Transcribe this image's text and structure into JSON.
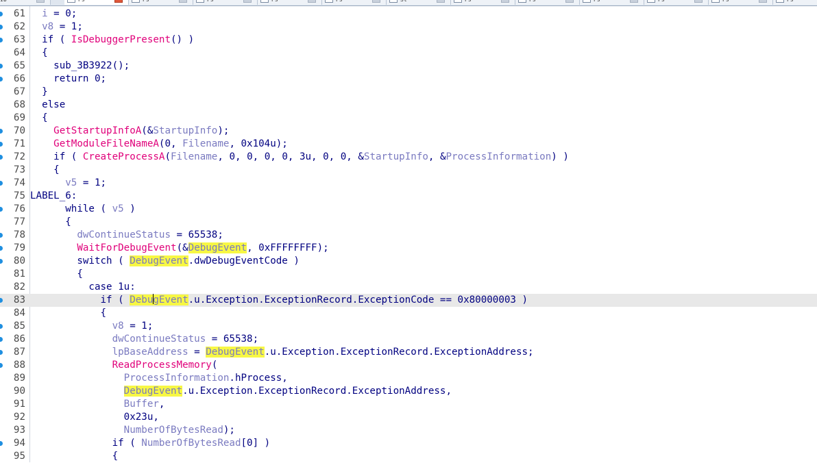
{
  "tabs": [
    {
      "label": "Ib",
      "active": false
    },
    {
      "label": "Ps",
      "active": true
    },
    {
      "label": "Ps",
      "active": false
    },
    {
      "label": "Ps",
      "active": false
    },
    {
      "label": "Ps",
      "active": false
    },
    {
      "label": "Ps",
      "active": false
    },
    {
      "label": "St",
      "active": false
    },
    {
      "label": "Ps",
      "active": false
    },
    {
      "label": "Ps",
      "active": false
    },
    {
      "label": "Ps",
      "active": false
    },
    {
      "label": "Ps",
      "active": false
    },
    {
      "label": "Ps",
      "active": false
    },
    {
      "label": "Ps",
      "active": false
    },
    {
      "label": "Ps",
      "active": false
    }
  ],
  "colors": {
    "keyword": "#000080",
    "variable": "#7a7ac0",
    "function": "#e0007a",
    "highlight": "#f7f744",
    "current_line": "#e8e8e8",
    "gutter_dot": "#1f8fe0"
  },
  "highlight_word": "DebugEvent",
  "current_line": 83,
  "lines": [
    {
      "num": "61",
      "dot": true,
      "tokens": [
        [
          "p",
          "  "
        ],
        [
          "v",
          "i"
        ],
        [
          "p",
          " = 0;"
        ]
      ]
    },
    {
      "num": "62",
      "dot": true,
      "tokens": [
        [
          "p",
          "  "
        ],
        [
          "v",
          "v8"
        ],
        [
          "p",
          " = 1;"
        ]
      ]
    },
    {
      "num": "63",
      "dot": true,
      "tokens": [
        [
          "p",
          "  if ( "
        ],
        [
          "f",
          "IsDebuggerPresent"
        ],
        [
          "p",
          "() )"
        ]
      ]
    },
    {
      "num": "64",
      "dot": false,
      "tokens": [
        [
          "p",
          "  {"
        ]
      ]
    },
    {
      "num": "65",
      "dot": true,
      "tokens": [
        [
          "p",
          "    sub_3B3922();"
        ]
      ]
    },
    {
      "num": "66",
      "dot": true,
      "tokens": [
        [
          "p",
          "    return 0;"
        ]
      ]
    },
    {
      "num": "67",
      "dot": false,
      "tokens": [
        [
          "p",
          "  }"
        ]
      ]
    },
    {
      "num": "68",
      "dot": false,
      "tokens": [
        [
          "p",
          "  else"
        ]
      ]
    },
    {
      "num": "69",
      "dot": false,
      "tokens": [
        [
          "p",
          "  {"
        ]
      ]
    },
    {
      "num": "70",
      "dot": true,
      "tokens": [
        [
          "p",
          "    "
        ],
        [
          "f",
          "GetStartupInfoA"
        ],
        [
          "p",
          "(&"
        ],
        [
          "v",
          "StartupInfo"
        ],
        [
          "p",
          ");"
        ]
      ]
    },
    {
      "num": "71",
      "dot": true,
      "tokens": [
        [
          "p",
          "    "
        ],
        [
          "f",
          "GetModuleFileNameA"
        ],
        [
          "p",
          "(0, "
        ],
        [
          "v",
          "Filename"
        ],
        [
          "p",
          ", 0x104u);"
        ]
      ]
    },
    {
      "num": "72",
      "dot": true,
      "tokens": [
        [
          "p",
          "    if ( "
        ],
        [
          "f",
          "CreateProcessA"
        ],
        [
          "p",
          "("
        ],
        [
          "v",
          "Filename"
        ],
        [
          "p",
          ", 0, 0, 0, 0, 3u, 0, 0, &"
        ],
        [
          "v",
          "StartupInfo"
        ],
        [
          "p",
          ", &"
        ],
        [
          "v",
          "ProcessInformation"
        ],
        [
          "p",
          ") )"
        ]
      ]
    },
    {
      "num": "73",
      "dot": false,
      "tokens": [
        [
          "p",
          "    {"
        ]
      ]
    },
    {
      "num": "74",
      "dot": true,
      "tokens": [
        [
          "p",
          "      "
        ],
        [
          "v",
          "v5"
        ],
        [
          "p",
          " = 1;"
        ]
      ]
    },
    {
      "num": "75",
      "dot": false,
      "tokens": [
        [
          "p",
          "LABEL_6:"
        ]
      ]
    },
    {
      "num": "76",
      "dot": true,
      "tokens": [
        [
          "p",
          "      while ( "
        ],
        [
          "v",
          "v5"
        ],
        [
          "p",
          " )"
        ]
      ]
    },
    {
      "num": "77",
      "dot": false,
      "tokens": [
        [
          "p",
          "      {"
        ]
      ]
    },
    {
      "num": "78",
      "dot": true,
      "tokens": [
        [
          "p",
          "        "
        ],
        [
          "v",
          "dwContinueStatus"
        ],
        [
          "p",
          " = 65538;"
        ]
      ]
    },
    {
      "num": "79",
      "dot": true,
      "tokens": [
        [
          "p",
          "        "
        ],
        [
          "f",
          "WaitForDebugEvent"
        ],
        [
          "p",
          "(&"
        ],
        [
          "h",
          "DebugEvent"
        ],
        [
          "p",
          ", 0xFFFFFFFF);"
        ]
      ]
    },
    {
      "num": "80",
      "dot": true,
      "tokens": [
        [
          "p",
          "        switch ( "
        ],
        [
          "h",
          "DebugEvent"
        ],
        [
          "p",
          ".dwDebugEventCode )"
        ]
      ]
    },
    {
      "num": "81",
      "dot": false,
      "tokens": [
        [
          "p",
          "        {"
        ]
      ]
    },
    {
      "num": "82",
      "dot": false,
      "tokens": [
        [
          "p",
          "          case 1u:"
        ]
      ]
    },
    {
      "num": "83",
      "dot": true,
      "tokens": [
        [
          "p",
          "            if ( "
        ],
        [
          "hc",
          "Debu|gEvent"
        ],
        [
          "p",
          ".u.Exception.ExceptionRecord.ExceptionCode == 0x80000003 )"
        ]
      ]
    },
    {
      "num": "84",
      "dot": false,
      "tokens": [
        [
          "p",
          "            {"
        ]
      ]
    },
    {
      "num": "85",
      "dot": true,
      "tokens": [
        [
          "p",
          "              "
        ],
        [
          "v",
          "v8"
        ],
        [
          "p",
          " = 1;"
        ]
      ]
    },
    {
      "num": "86",
      "dot": true,
      "tokens": [
        [
          "p",
          "              "
        ],
        [
          "v",
          "dwContinueStatus"
        ],
        [
          "p",
          " = 65538;"
        ]
      ]
    },
    {
      "num": "87",
      "dot": true,
      "tokens": [
        [
          "p",
          "              "
        ],
        [
          "v",
          "lpBaseAddress"
        ],
        [
          "p",
          " = "
        ],
        [
          "h",
          "DebugEvent"
        ],
        [
          "p",
          ".u.Exception.ExceptionRecord.ExceptionAddress;"
        ]
      ]
    },
    {
      "num": "88",
      "dot": true,
      "tokens": [
        [
          "p",
          "              "
        ],
        [
          "f",
          "ReadProcessMemory"
        ],
        [
          "p",
          "("
        ]
      ]
    },
    {
      "num": "89",
      "dot": false,
      "tokens": [
        [
          "p",
          "                "
        ],
        [
          "v",
          "ProcessInformation"
        ],
        [
          "p",
          ".hProcess,"
        ]
      ]
    },
    {
      "num": "90",
      "dot": false,
      "tokens": [
        [
          "p",
          "                "
        ],
        [
          "h",
          "DebugEvent"
        ],
        [
          "p",
          ".u.Exception.ExceptionRecord.ExceptionAddress,"
        ]
      ]
    },
    {
      "num": "91",
      "dot": false,
      "tokens": [
        [
          "p",
          "                "
        ],
        [
          "v",
          "Buffer"
        ],
        [
          "p",
          ","
        ]
      ]
    },
    {
      "num": "92",
      "dot": false,
      "tokens": [
        [
          "p",
          "                0x23u,"
        ]
      ]
    },
    {
      "num": "93",
      "dot": false,
      "tokens": [
        [
          "p",
          "                "
        ],
        [
          "v",
          "NumberOfBytesRead"
        ],
        [
          "p",
          ");"
        ]
      ]
    },
    {
      "num": "94",
      "dot": true,
      "tokens": [
        [
          "p",
          "              if ( "
        ],
        [
          "v",
          "NumberOfBytesRead"
        ],
        [
          "p",
          "[0] )"
        ]
      ]
    },
    {
      "num": "95",
      "dot": false,
      "tokens": [
        [
          "p",
          "              {"
        ]
      ]
    }
  ]
}
